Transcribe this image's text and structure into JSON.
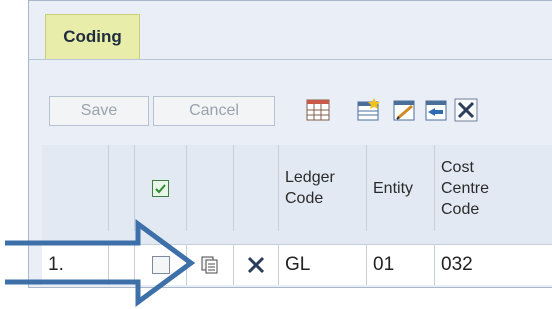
{
  "tab": {
    "label": "Coding"
  },
  "toolbar": {
    "save_label": "Save",
    "cancel_label": "Cancel",
    "tools": [
      "grid-icon",
      "add-row-icon",
      "edit-icon",
      "import-icon",
      "close-icon"
    ]
  },
  "table": {
    "headers": {
      "ledger_code": "Ledger\nCode",
      "entity": "Entity",
      "cost_centre_code": "Cost\nCentre\nCode"
    },
    "rows": [
      {
        "number": "1.",
        "ledger_code": "GL",
        "entity": "01",
        "cost_centre_code": "032"
      }
    ]
  },
  "colors": {
    "accent_tab": "#e8eda9",
    "arrow": "#3d6fa8"
  }
}
